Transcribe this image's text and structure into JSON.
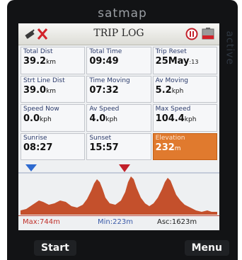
{
  "device": {
    "brand": "satmap",
    "side_brand": "active"
  },
  "header": {
    "title": "TRIP LOG"
  },
  "cells": [
    {
      "label": "Total Dist",
      "value": "39.2",
      "unit": "km"
    },
    {
      "label": "Total Time",
      "value": "09:49",
      "unit": ""
    },
    {
      "label": "Trip Reset",
      "value": "25May",
      "unit": ":13"
    },
    {
      "label": "Strt Line Dist",
      "value": "39.0",
      "unit": "km"
    },
    {
      "label": "Time Moving",
      "value": "07:32",
      "unit": ""
    },
    {
      "label": "Av Moving",
      "value": "5.2",
      "unit": "kph"
    },
    {
      "label": "Speed Now",
      "value": "0.0",
      "unit": "kph"
    },
    {
      "label": "Av Speed",
      "value": "4.0",
      "unit": "kph"
    },
    {
      "label": "Max Speed",
      "value": "104.4",
      "unit": "kph"
    },
    {
      "label": "Sunrise",
      "value": "08:27",
      "unit": ""
    },
    {
      "label": "Sunset",
      "value": "15:57",
      "unit": ""
    },
    {
      "label": "Elevation",
      "value": "232",
      "unit": "m"
    }
  ],
  "profile": {
    "max_label": "Max:744m",
    "min_label": "Min:223m",
    "asc_label": "Asc:1623m",
    "fill_color": "#c4502c",
    "start_marker_color": "#2d6ad0",
    "position_marker_color": "#c2202a"
  },
  "softkeys": {
    "left": "Start",
    "right": "Menu"
  }
}
